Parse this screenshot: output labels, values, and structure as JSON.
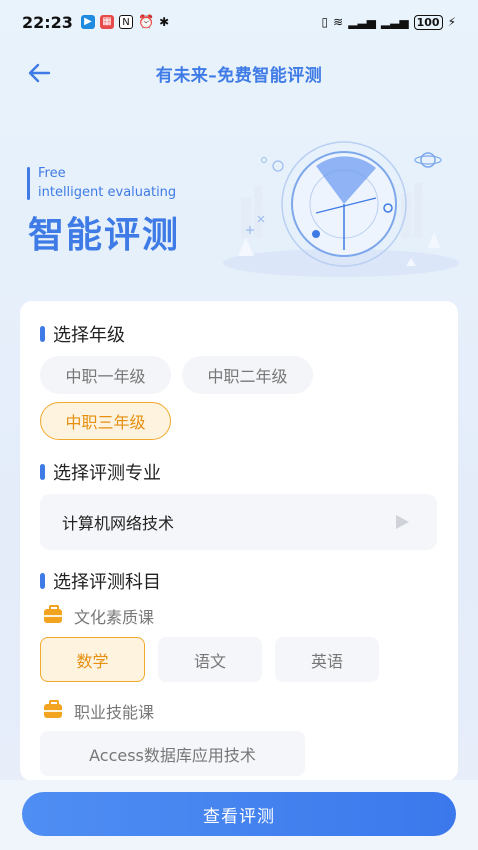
{
  "status_bar": {
    "time": "22:23",
    "battery": "100"
  },
  "nav": {
    "title": "有未来–免费智能评测"
  },
  "hero": {
    "en_line1": "Free",
    "en_line2": "intelligent evaluating",
    "cn_title": "智能评测"
  },
  "grade_section": {
    "title": "选择年级",
    "options": [
      "中职一年级",
      "中职二年级",
      "中职三年级"
    ],
    "selected": "中职三年级"
  },
  "major_section": {
    "title": "选择评测专业",
    "value": "计算机网络技术"
  },
  "subject_section": {
    "title": "选择评测科目",
    "groups": [
      {
        "label": "文化素质课",
        "options": [
          "数学",
          "语文",
          "英语"
        ],
        "selected": "数学"
      },
      {
        "label": "职业技能课",
        "options": [
          "Access数据库应用技术"
        ]
      }
    ]
  },
  "actions": {
    "submit_label": "查看评测"
  },
  "colors": {
    "accent": "#3f7be6",
    "selected_border": "#f0a92d",
    "selected_text": "#e68f10"
  }
}
